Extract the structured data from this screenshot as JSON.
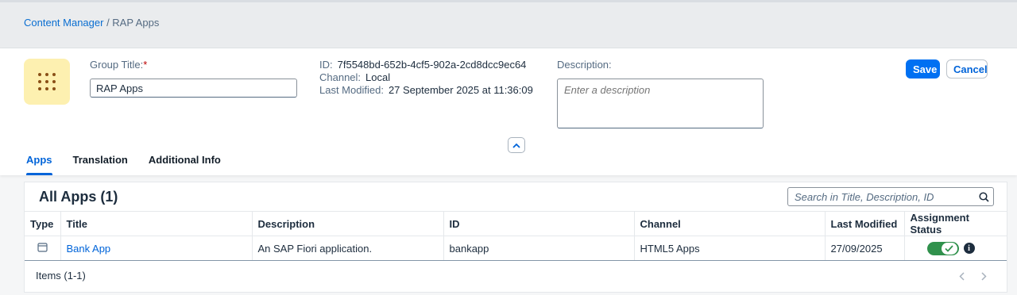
{
  "breadcrumb": {
    "root": "Content Manager",
    "separator": " / ",
    "current": "RAP Apps"
  },
  "group": {
    "icon": "grid-icon",
    "title_label": "Group Title:",
    "required_mark": "*",
    "title_value": "RAP Apps",
    "id_label": "ID:",
    "id_value": "7f5548bd-652b-4cf5-902a-2cd8dcc9ec64",
    "channel_label": "Channel:",
    "channel_value": "Local",
    "modified_label": "Last Modified:",
    "modified_value": "27 September 2025 at 11:36:09",
    "description_label": "Description:",
    "description_placeholder": "Enter a description",
    "description_value": ""
  },
  "actions": {
    "save": "Save",
    "cancel": "Cancel"
  },
  "tabs": [
    {
      "label": "Apps",
      "active": true
    },
    {
      "label": "Translation",
      "active": false
    },
    {
      "label": "Additional Info",
      "active": false
    }
  ],
  "apps": {
    "title": "All Apps (1)",
    "search_placeholder": "Search in Title, Description, ID",
    "columns": [
      "Type",
      "Title",
      "Description",
      "ID",
      "Channel",
      "Last Modified",
      "Assignment Status"
    ],
    "rows": [
      {
        "type_icon": "app-window-icon",
        "title": "Bank App",
        "description": "An SAP Fiori application.",
        "id": "bankapp",
        "channel": "HTML5 Apps",
        "last_modified": "27/09/2025",
        "assigned": true
      }
    ],
    "footer": "Items (1-1)"
  },
  "colors": {
    "accent": "#0070f2",
    "link": "#0064d9",
    "switch_on": "#30914c",
    "group_icon_bg": "#fdf0b0"
  }
}
